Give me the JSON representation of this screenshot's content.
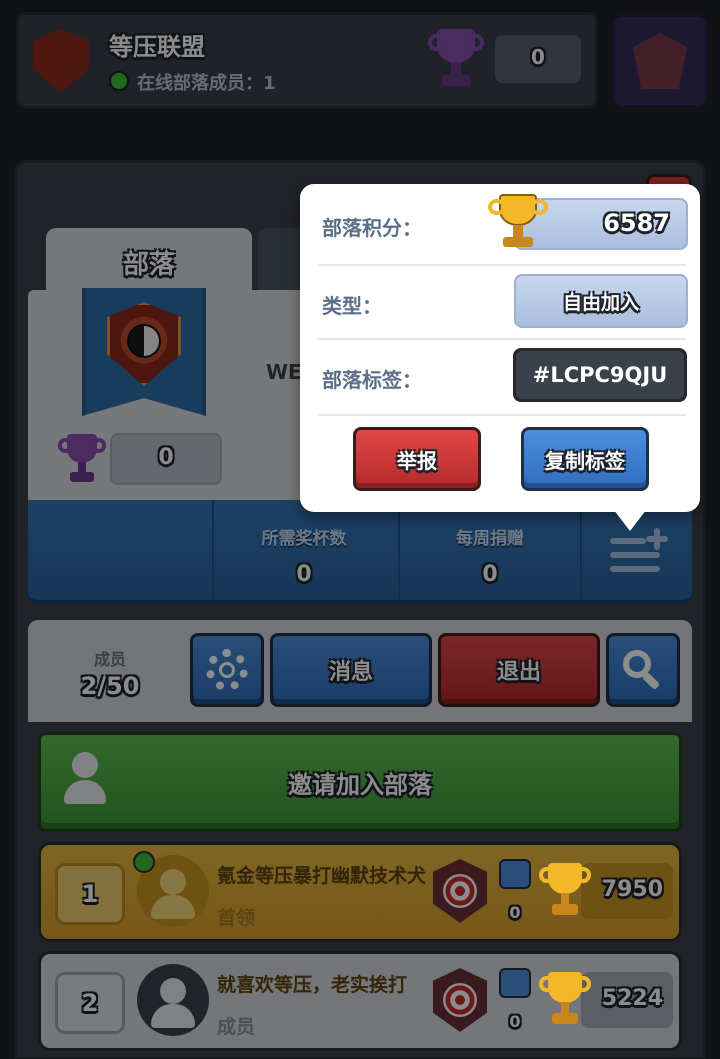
{
  "header": {
    "clan_name": "等压联盟",
    "online_label": "在线部落成员：1",
    "trophies": "0"
  },
  "tabs": {
    "clan": "部落"
  },
  "clan_info": {
    "name_partial": "WE",
    "trophies": "0"
  },
  "stats": {
    "required_trophies_label": "所需奖杯数",
    "required_trophies_value": "0",
    "weekly_donations_label": "每周捐赠",
    "weekly_donations_value": "0"
  },
  "members_bar": {
    "label": "成员",
    "count": "2/50",
    "messages_label": "消息",
    "leave_label": "退出"
  },
  "invite": {
    "label": "邀请加入部落"
  },
  "members": [
    {
      "rank": "1",
      "name": "氪金等压暴打幽默技术犬",
      "role": "首领",
      "donations": "0",
      "trophies": "7950",
      "online": true
    },
    {
      "rank": "2",
      "name": "就喜欢等压，老实挨打",
      "role": "成员",
      "donations": "0",
      "trophies": "5224",
      "online": false
    }
  ],
  "popup": {
    "score_label": "部落积分：",
    "score_value": "6587",
    "type_label": "类型：",
    "type_value": "自由加入",
    "tag_label": "部落标签：",
    "tag_value": "#LCPC9QJU",
    "report_label": "举报",
    "copy_label": "复制标签"
  },
  "icons": {
    "trophy_gold": "trophy-icon",
    "trophy_purple": "trophy-icon",
    "settings": "gear-icon",
    "search": "search-icon",
    "add_member": "add-member-icon",
    "person": "person-icon",
    "target": "target-icon",
    "donate": "donate-icon"
  },
  "colors": {
    "gold": "#e8b844",
    "blue": "#3577b9",
    "red": "#d83a3a",
    "green": "#4caf45",
    "purple": "#8a4fb0"
  }
}
